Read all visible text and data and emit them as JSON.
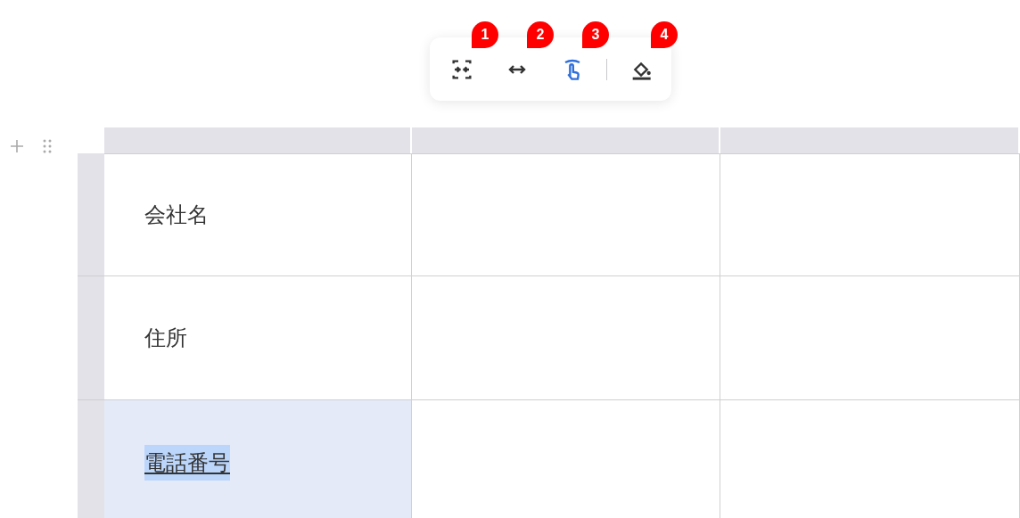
{
  "toolbar": {
    "tools": [
      {
        "kind": "fit",
        "badge": "1",
        "selected": false
      },
      {
        "kind": "width",
        "badge": "2",
        "selected": false
      },
      {
        "kind": "touch",
        "badge": "3",
        "selected": true
      },
      {
        "kind": "fill",
        "badge": "4",
        "selected": false
      }
    ]
  },
  "table": {
    "rows": [
      {
        "cells": [
          {
            "text": "会社名",
            "selected": false
          },
          {
            "text": "",
            "selected": false
          },
          {
            "text": "",
            "selected": false
          }
        ]
      },
      {
        "cells": [
          {
            "text": "住所",
            "selected": false
          },
          {
            "text": "",
            "selected": false
          },
          {
            "text": "",
            "selected": false
          }
        ]
      },
      {
        "cells": [
          {
            "text": "電話番号",
            "selected": true
          },
          {
            "text": "",
            "selected": false
          },
          {
            "text": "",
            "selected": false
          }
        ]
      }
    ]
  }
}
